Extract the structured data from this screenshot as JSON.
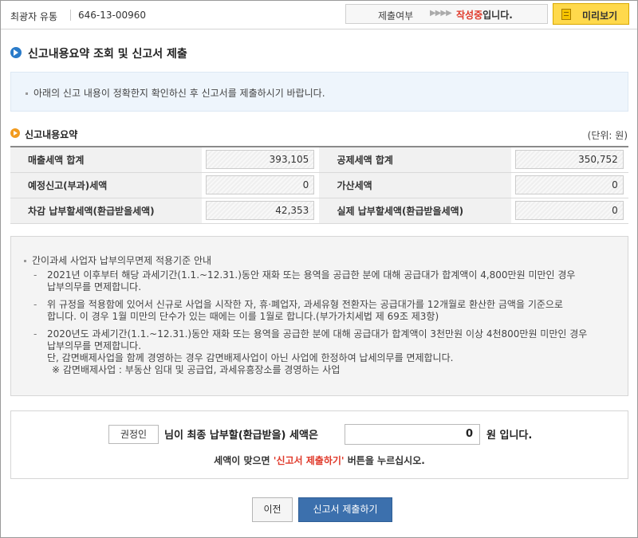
{
  "header": {
    "business_name": "최광자 유통",
    "business_number": "646-13-00960",
    "status_label": "제출여부",
    "status_arrows": "▶▶▶▶",
    "status_value_red": "작성중",
    "status_value_suffix": "입니다.",
    "preview_button": "미리보기"
  },
  "page_title": "신고내용요약 조회 및 신고서 제출",
  "info_text": "아래의 신고 내용이 정확한지 확인하신 후 신고서를 제출하시기 바랍니다.",
  "summary": {
    "title": "신고내용요약",
    "unit": "(단위: 원)",
    "rows": [
      {
        "left_label": "매출세액 합계",
        "left_value": "393,105",
        "right_label": "공제세액 합계",
        "right_value": "350,752"
      },
      {
        "left_label": "예정신고(부과)세액",
        "left_value": "0",
        "right_label": "가산세액",
        "right_value": "0"
      },
      {
        "left_label": "차감 납부할세액(환급받을세액)",
        "left_value": "42,353",
        "right_label": "실제 납부할세액(환급받을세액)",
        "right_value": "0"
      }
    ]
  },
  "notice": {
    "heading": "간이과세 사업자 납부의무면제 적용기준 안내",
    "items": [
      {
        "line1": "2021년 이후부터 해당  과세기간(1.1.~12.31.)동안 재화 또는 용역을 공급한 분에 대해 공급대가 합계액이 4,800만원 미만인 경우",
        "line2": "납부의무를 면제합니다.",
        "line3": "",
        "line4": ""
      },
      {
        "line1": "위 규정을 적용함에 있어서 신규로 사업을 시작한 자, 휴·폐업자, 과세유형 전환자는 공급대가를 12개월로 환산한 금액을 기준으로",
        "line2": "합니다. 이 경우 1월 미만의 단수가 있는 때에는 이를 1월로 합니다.(부가가치세법 제 69조 제3항)",
        "line3": "",
        "line4": ""
      },
      {
        "line1": "2020년도 과세기간(1.1.~12.31.)동안 재화 또는 용역을 공급한 분에 대해 공급대가 합계액이 3천만원 이상 4천800만원 미만인 경우",
        "line2": "납부의무를 면제합니다.",
        "line3": "단, 감면배제사업을 함께 경영하는 경우 감면배제사업이 아닌 사업에 한정하여 납세의무를 면제합니다.",
        "line4": "※ 감면배제사업 : 부동산 임대 및 공급업, 과세유흥장소를 경영하는 사업"
      }
    ]
  },
  "final": {
    "name": "권정인",
    "text1": "님이 최종 납부할(환급받을) 세액은",
    "amount": "0",
    "text2": "원 입니다.",
    "msg_prefix": "세액이 맞으면 ",
    "msg_red": "'신고서 제출하기'",
    "msg_suffix": " 버튼을 누르십시오."
  },
  "buttons": {
    "prev": "이전",
    "submit": "신고서 제출하기"
  },
  "colors": {
    "accent_red": "#e0392a",
    "submit_blue": "#3c70ad",
    "preview_yellow": "#ffd94c"
  }
}
